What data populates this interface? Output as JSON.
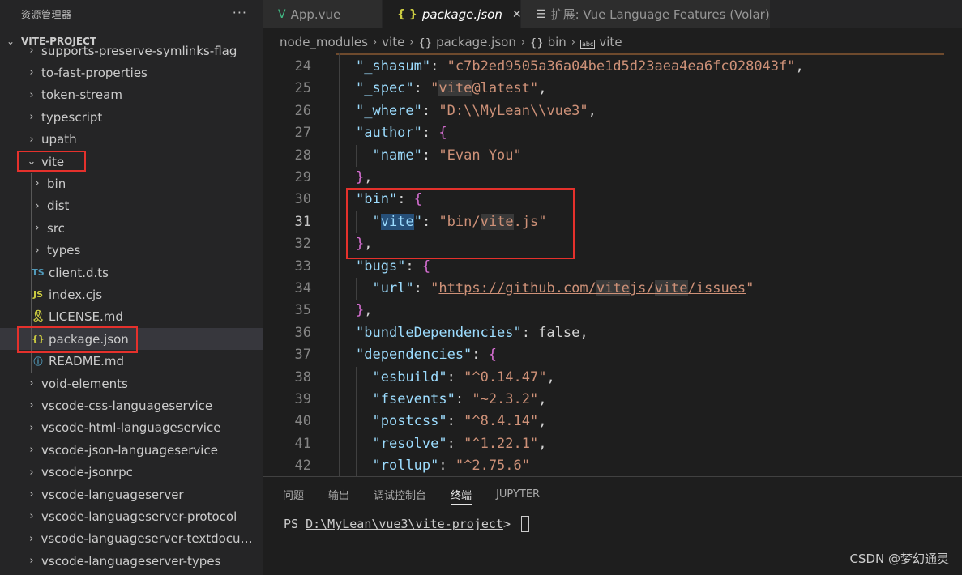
{
  "sidebar": {
    "title": "资源管理器",
    "more": "···",
    "project": "VITE-PROJECT",
    "items": [
      {
        "label": "supports-preserve-symlinks-flag",
        "type": "folder",
        "expanded": false,
        "depth": 0
      },
      {
        "label": "to-fast-properties",
        "type": "folder",
        "expanded": false,
        "depth": 0
      },
      {
        "label": "token-stream",
        "type": "folder",
        "expanded": false,
        "depth": 0
      },
      {
        "label": "typescript",
        "type": "folder",
        "expanded": false,
        "depth": 0
      },
      {
        "label": "upath",
        "type": "folder",
        "expanded": false,
        "depth": 0
      },
      {
        "label": "vite",
        "type": "folder",
        "expanded": true,
        "depth": 0
      },
      {
        "label": "bin",
        "type": "folder",
        "expanded": false,
        "depth": 1
      },
      {
        "label": "dist",
        "type": "folder",
        "expanded": false,
        "depth": 1
      },
      {
        "label": "src",
        "type": "folder",
        "expanded": false,
        "depth": 1
      },
      {
        "label": "types",
        "type": "folder",
        "expanded": false,
        "depth": 1
      },
      {
        "label": "client.d.ts",
        "type": "file",
        "icon": "ts-icon",
        "icon_text": "TS",
        "depth": 1
      },
      {
        "label": "index.cjs",
        "type": "file",
        "icon": "js-icon",
        "icon_text": "JS",
        "depth": 1
      },
      {
        "label": "LICENSE.md",
        "type": "file",
        "icon": "license-icon",
        "icon_text": "🎗",
        "depth": 1
      },
      {
        "label": "package.json",
        "type": "file",
        "icon": "json-icon",
        "icon_text": "{}",
        "depth": 1,
        "selected": true
      },
      {
        "label": "README.md",
        "type": "file",
        "icon": "info-icon",
        "icon_text": "ⓘ",
        "depth": 1
      },
      {
        "label": "void-elements",
        "type": "folder",
        "expanded": false,
        "depth": 0
      },
      {
        "label": "vscode-css-languageservice",
        "type": "folder",
        "expanded": false,
        "depth": 0
      },
      {
        "label": "vscode-html-languageservice",
        "type": "folder",
        "expanded": false,
        "depth": 0
      },
      {
        "label": "vscode-json-languageservice",
        "type": "folder",
        "expanded": false,
        "depth": 0
      },
      {
        "label": "vscode-jsonrpc",
        "type": "folder",
        "expanded": false,
        "depth": 0
      },
      {
        "label": "vscode-languageserver",
        "type": "folder",
        "expanded": false,
        "depth": 0
      },
      {
        "label": "vscode-languageserver-protocol",
        "type": "folder",
        "expanded": false,
        "depth": 0
      },
      {
        "label": "vscode-languageserver-textdocume...",
        "type": "folder",
        "expanded": false,
        "depth": 0
      },
      {
        "label": "vscode-languageserver-types",
        "type": "folder",
        "expanded": false,
        "depth": 0
      }
    ]
  },
  "tabs": [
    {
      "label": "App.vue",
      "icon": "vue-icon",
      "icon_text": "V",
      "active": false
    },
    {
      "label": "package.json",
      "icon": "json-icon",
      "icon_text": "{ }",
      "active": true,
      "close": "✕"
    },
    {
      "label": "扩展: Vue Language Features (Volar)",
      "icon": "extension-icon",
      "icon_text": "☰",
      "active": false
    }
  ],
  "breadcrumb": [
    "node_modules",
    "vite",
    "package.json",
    "bin",
    "vite"
  ],
  "editor": {
    "current_line": 31,
    "lines": [
      {
        "n": "24",
        "code": "\"_shasum\": \"c7b2ed9505a36a04be1d5d23aea4ea6fc028043f\","
      },
      {
        "n": "25",
        "code": "\"_spec\": \"vite@latest\","
      },
      {
        "n": "26",
        "code": "\"_where\": \"D:\\\\MyLean\\\\vue3\","
      },
      {
        "n": "27",
        "code": "\"author\": {"
      },
      {
        "n": "28",
        "code": "  \"name\": \"Evan You\""
      },
      {
        "n": "29",
        "code": "},"
      },
      {
        "n": "30",
        "code": "\"bin\": {"
      },
      {
        "n": "31",
        "code": "  \"vite\": \"bin/vite.js\""
      },
      {
        "n": "32",
        "code": "},"
      },
      {
        "n": "33",
        "code": "\"bugs\": {"
      },
      {
        "n": "34",
        "code": "  \"url\": \"https://github.com/vitejs/vite/issues\""
      },
      {
        "n": "35",
        "code": "},"
      },
      {
        "n": "36",
        "code": "\"bundleDependencies\": false,"
      },
      {
        "n": "37",
        "code": "\"dependencies\": {"
      },
      {
        "n": "38",
        "code": "  \"esbuild\": \"^0.14.47\","
      },
      {
        "n": "39",
        "code": "  \"fsevents\": \"~2.3.2\","
      },
      {
        "n": "40",
        "code": "  \"postcss\": \"^8.4.14\","
      },
      {
        "n": "41",
        "code": "  \"resolve\": \"^1.22.1\","
      },
      {
        "n": "42",
        "code": "  \"rollup\": \"^2.75.6\""
      }
    ]
  },
  "panel": {
    "tabs": [
      "问题",
      "输出",
      "调试控制台",
      "终端",
      "JUPYTER"
    ],
    "active_tab": "终端",
    "terminal_prefix": "PS ",
    "terminal_path": "D:\\MyLean\\vue3\\vite-project",
    "terminal_suffix": "> "
  },
  "watermark": "CSDN @梦幻通灵",
  "colors": {
    "annotation": "#e5312c",
    "key": "#9cdcfe",
    "string": "#ce9178",
    "bracket": "#da70d6",
    "boolean": "#569cd6"
  }
}
